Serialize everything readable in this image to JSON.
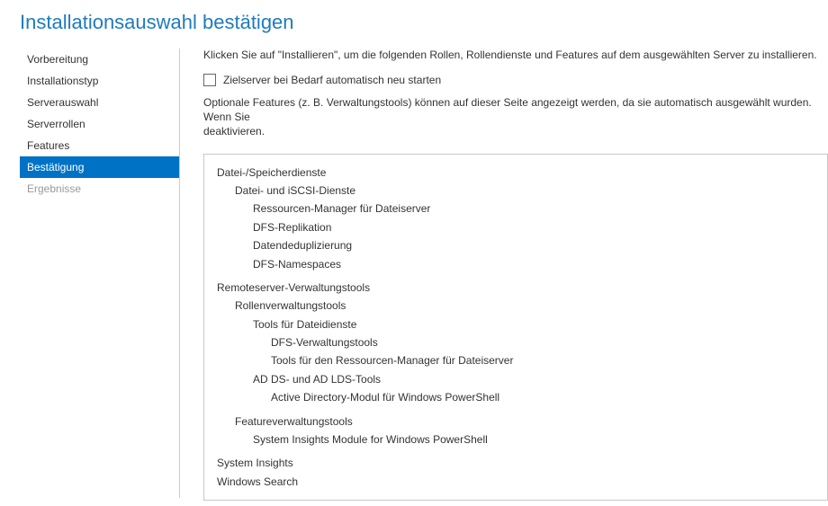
{
  "title": "Installationsauswahl bestätigen",
  "sidebar": {
    "items": [
      {
        "label": "Vorbereitung",
        "state": "normal"
      },
      {
        "label": "Installationstyp",
        "state": "normal"
      },
      {
        "label": "Serverauswahl",
        "state": "normal"
      },
      {
        "label": "Serverrollen",
        "state": "normal"
      },
      {
        "label": "Features",
        "state": "normal"
      },
      {
        "label": "Bestätigung",
        "state": "active"
      },
      {
        "label": "Ergebnisse",
        "state": "disabled"
      }
    ]
  },
  "main": {
    "intro": "Klicken Sie auf \"Installieren\", um die folgenden Rollen, Rollendienste und Features auf dem ausgewählten Server zu installieren.",
    "restart_checkbox_label": "Zielserver bei Bedarf automatisch neu starten",
    "restart_checked": false,
    "note": "Optionale Features (z. B. Verwaltungstools) können auf dieser Seite angezeigt werden, da sie automatisch ausgewählt wurden. Wenn Sie",
    "note_line2": "deaktivieren.",
    "tree": [
      {
        "level": 0,
        "label": "Datei-/Speicherdienste"
      },
      {
        "level": 1,
        "label": "Datei- und iSCSI-Dienste"
      },
      {
        "level": 2,
        "label": "Ressourcen-Manager für Dateiserver"
      },
      {
        "level": 2,
        "label": "DFS-Replikation"
      },
      {
        "level": 2,
        "label": "Datendeduplizierung"
      },
      {
        "level": 2,
        "label": "DFS-Namespaces"
      },
      {
        "gap": true
      },
      {
        "level": 0,
        "label": "Remoteserver-Verwaltungstools"
      },
      {
        "level": 1,
        "label": "Rollenverwaltungstools"
      },
      {
        "level": 2,
        "label": "Tools für Dateidienste"
      },
      {
        "level": 3,
        "label": "DFS-Verwaltungstools"
      },
      {
        "level": 3,
        "label": "Tools für den Ressourcen-Manager für Dateiserver"
      },
      {
        "level": 2,
        "label": "AD DS- und AD LDS-Tools"
      },
      {
        "level": 3,
        "label": "Active Directory-Modul für Windows PowerShell"
      },
      {
        "gap": true
      },
      {
        "level": 1,
        "label": "Featureverwaltungstools"
      },
      {
        "level": 2,
        "label": "System Insights Module for Windows PowerShell"
      },
      {
        "gap": true
      },
      {
        "level": 0,
        "label": "System Insights"
      },
      {
        "level": 0,
        "label": "Windows Search"
      }
    ]
  }
}
